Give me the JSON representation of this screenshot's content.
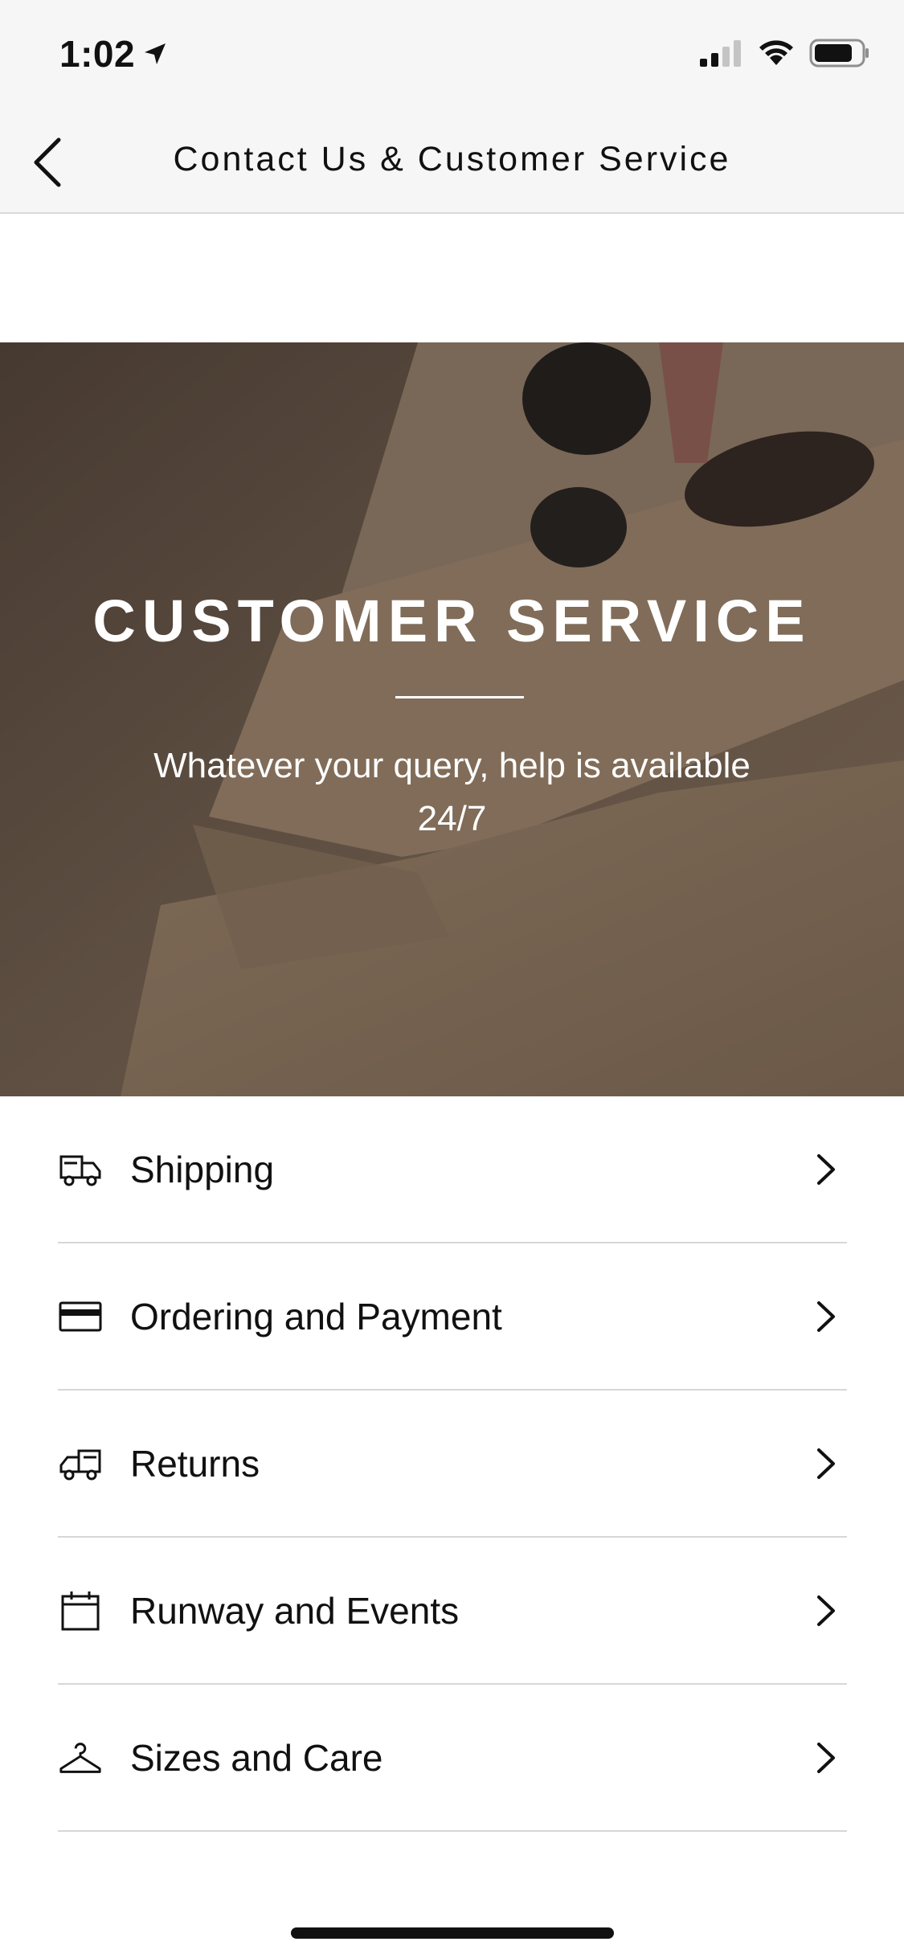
{
  "status_bar": {
    "time": "1:02",
    "icons": [
      "location-arrow-icon",
      "cellular-signal-icon",
      "wifi-icon",
      "battery-icon"
    ]
  },
  "nav": {
    "title": "Contact Us & Customer Service",
    "back_icon": "chevron-left-icon"
  },
  "hero": {
    "title": "CUSTOMER SERVICE",
    "subtitle": "Whatever your query, help is available 24/7"
  },
  "menu": {
    "items": [
      {
        "label": "Shipping",
        "icon": "delivery-truck-icon"
      },
      {
        "label": "Ordering and Payment",
        "icon": "credit-card-icon"
      },
      {
        "label": "Returns",
        "icon": "return-truck-icon"
      },
      {
        "label": "Runway and Events",
        "icon": "calendar-icon"
      },
      {
        "label": "Sizes and Care",
        "icon": "hanger-icon"
      }
    ]
  },
  "colors": {
    "bar_background": "#f6f6f6",
    "text": "#111111",
    "divider": "#d7d7d7",
    "hero_text": "#ffffff"
  }
}
